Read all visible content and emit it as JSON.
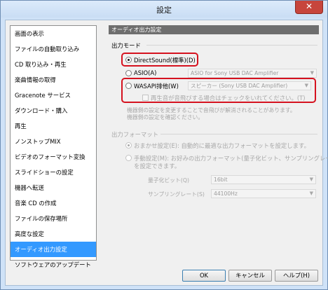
{
  "window": {
    "title": "設定",
    "close_glyph": "✕"
  },
  "sidebar": {
    "items": [
      {
        "label": "画面の表示"
      },
      {
        "label": "ファイルの自動取り込み"
      },
      {
        "label": "CD 取り込み・再生"
      },
      {
        "label": "楽曲情報の取得"
      },
      {
        "label": "Gracenote サービス"
      },
      {
        "label": "ダウンロード・購入"
      },
      {
        "label": "再生"
      },
      {
        "label": "ノンストップMIX"
      },
      {
        "label": "ビデオのフォーマット変換"
      },
      {
        "label": "スライドショーの設定"
      },
      {
        "label": "機器へ転送"
      },
      {
        "label": "音楽 CD の作成"
      },
      {
        "label": "ファイルの保存場所"
      },
      {
        "label": "高度な設定"
      },
      {
        "label": "オーディオ出力設定"
      },
      {
        "label": "ソフトウェアのアップデート"
      }
    ],
    "selected_index": 14
  },
  "panel": {
    "header": "オーディオ出力設定",
    "output_mode": {
      "label": "出力モード",
      "directsound_label": "DirectSound(標準)(D)",
      "asio_label": "ASIO(A)",
      "asio_device": "ASIO for Sony USB DAC Amplifier",
      "wasapi_label": "WASAPI排他(W)",
      "wasapi_device": "スピーカー (Sony USB DAC Amplifier)",
      "check_label": "再生音が音飛びする場合はチェックをいれてください。(T)",
      "note_line1": "機器側の設定を変更することで音飛びが解消されることがあります。",
      "note_line2": "機器側の設定を確認ください。"
    },
    "output_format": {
      "label": "出力フォーマット",
      "auto_label": "おまかせ設定(E): 自動的に最適な出力フォーマットを設定します。",
      "manual_label_line1": "手動設定(M): お好みの出力フォーマット(量子化ビット、サンプリングレート)",
      "manual_label_line2": "を設定できます。",
      "bit_label": "量子化ビット(Q)",
      "bit_value": "16bit",
      "rate_label": "サンプリングレート(S)",
      "rate_value": "44100Hz"
    }
  },
  "buttons": {
    "ok": "OK",
    "cancel": "キャンセル",
    "help": "ヘルプ(H)"
  },
  "colors": {
    "highlight": "#d5121f",
    "selected": "#3399ff"
  }
}
